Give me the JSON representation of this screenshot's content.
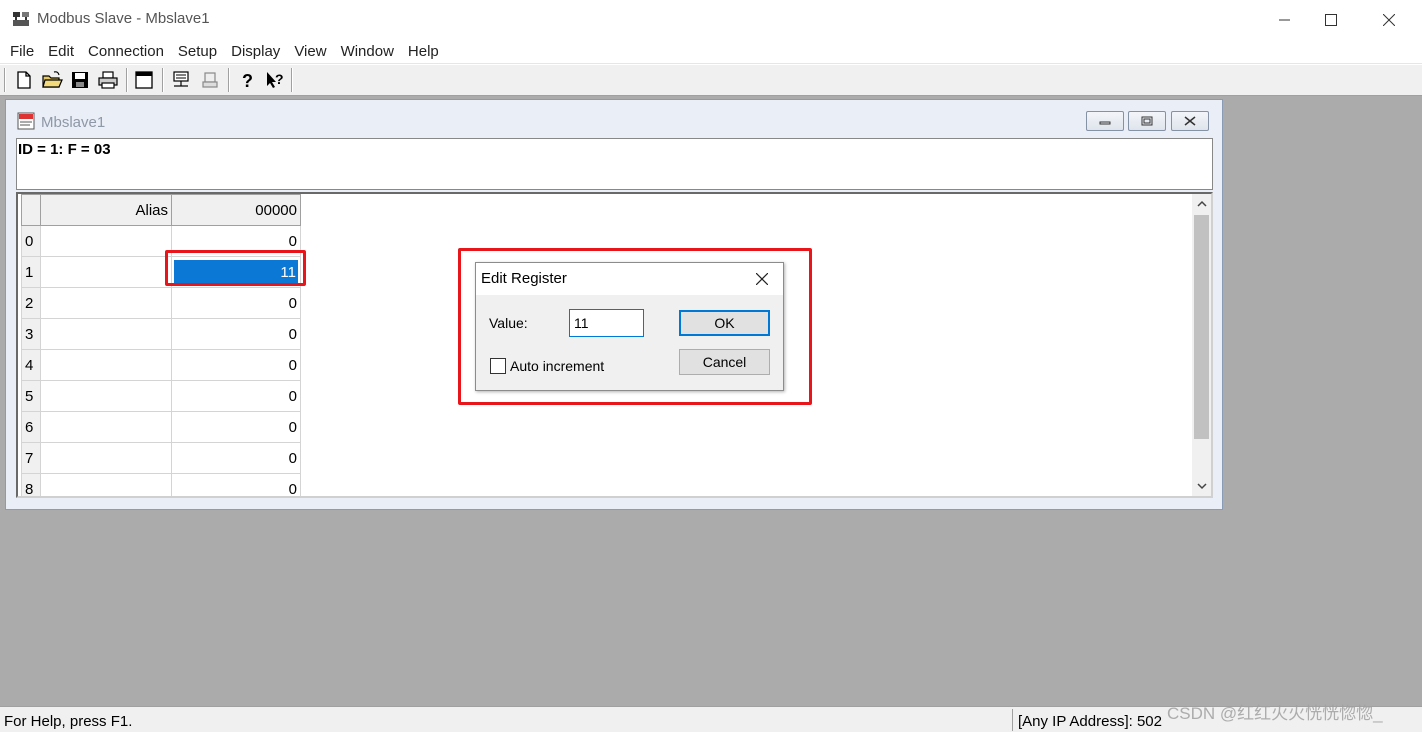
{
  "window": {
    "title": "Modbus Slave - Mbslave1"
  },
  "menu": [
    "File",
    "Edit",
    "Connection",
    "Setup",
    "Display",
    "View",
    "Window",
    "Help"
  ],
  "toolbar": {
    "icons": [
      "new-document-icon",
      "open-folder-icon",
      "save-icon",
      "print-icon",
      "window-icon",
      "connect-icon",
      "disconnect-icon",
      "help-icon",
      "context-help-icon"
    ]
  },
  "child": {
    "title": "Mbslave1",
    "info": "ID = 1: F = 03",
    "grid": {
      "alias_header": "Alias",
      "col_header": "00000",
      "rows": [
        {
          "num": "0",
          "alias": "",
          "value": "0"
        },
        {
          "num": "1",
          "alias": "",
          "value": "11"
        },
        {
          "num": "2",
          "alias": "",
          "value": "0"
        },
        {
          "num": "3",
          "alias": "",
          "value": "0"
        },
        {
          "num": "4",
          "alias": "",
          "value": "0"
        },
        {
          "num": "5",
          "alias": "",
          "value": "0"
        },
        {
          "num": "6",
          "alias": "",
          "value": "0"
        },
        {
          "num": "7",
          "alias": "",
          "value": "0"
        },
        {
          "num": "8",
          "alias": "",
          "value": "0"
        }
      ],
      "selected_row": 1
    }
  },
  "dialog": {
    "title": "Edit Register",
    "value_label": "Value:",
    "value": "11",
    "ok_label": "OK",
    "cancel_label": "Cancel",
    "auto_increment_label": "Auto increment",
    "auto_increment_checked": false
  },
  "status": {
    "help": "For Help, press F1.",
    "address": "[Any IP Address]: 502"
  },
  "watermark": "CSDN @红红火火恍恍惚惚_",
  "colors": {
    "highlight": "#e8151b",
    "selection": "#0a78d4",
    "accent": "#0078d7"
  }
}
